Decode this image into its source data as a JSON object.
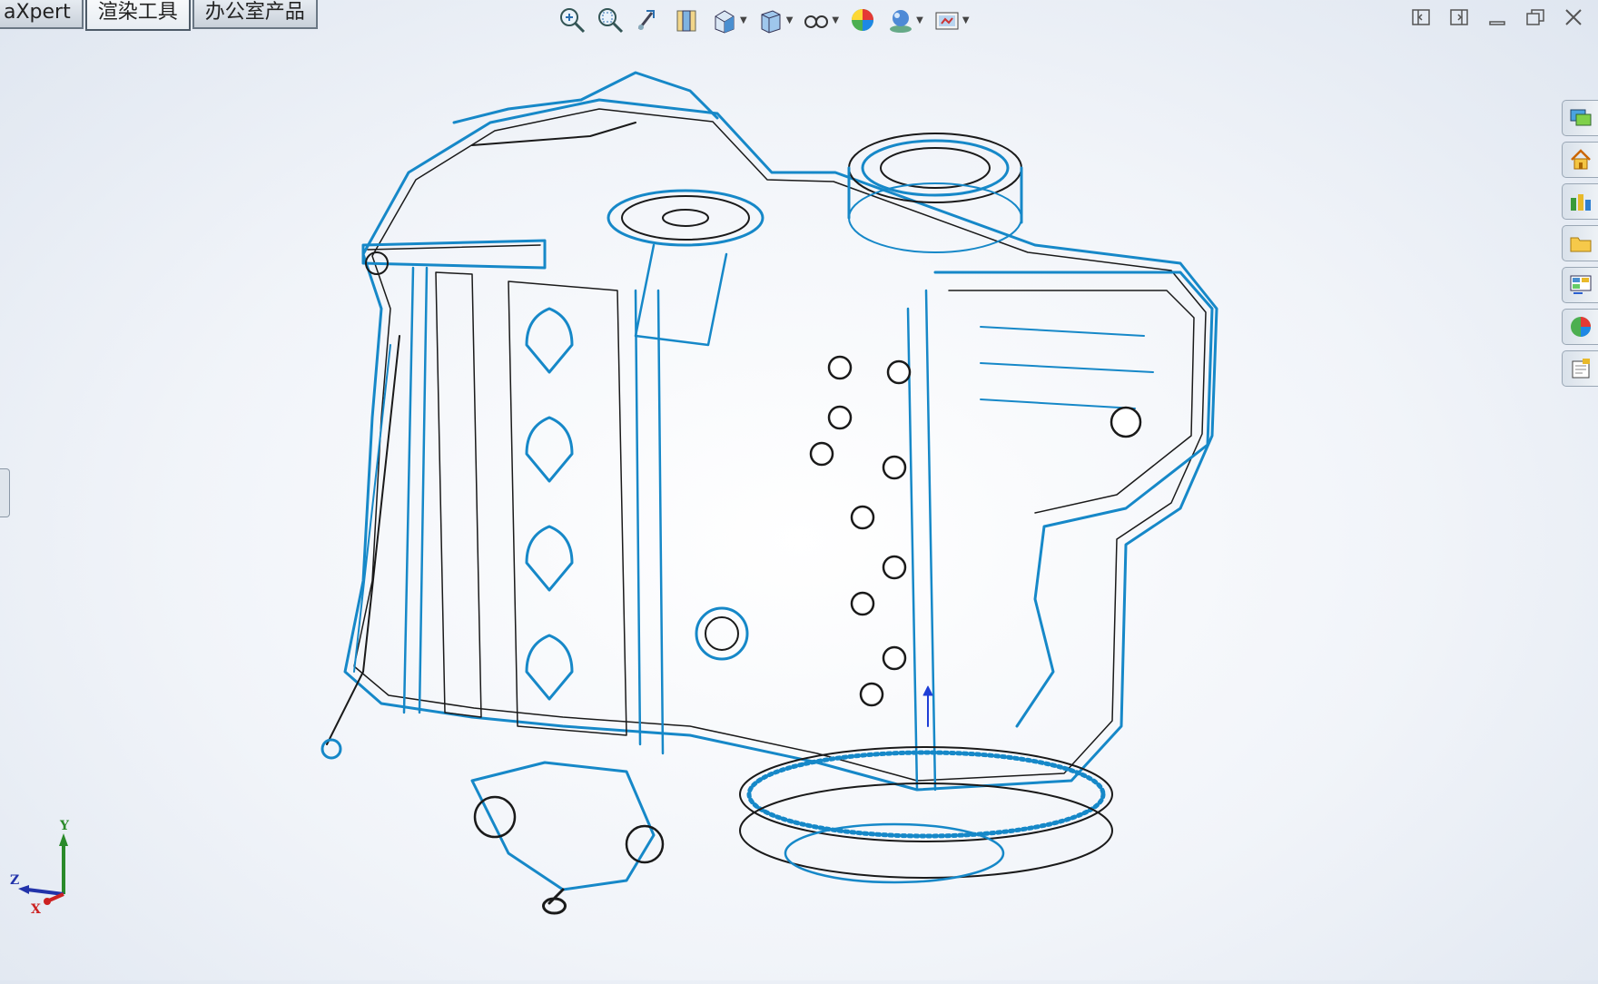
{
  "tabs": [
    {
      "label": "aXpert",
      "active": false
    },
    {
      "label": "渲染工具",
      "active": true
    },
    {
      "label": "办公室产品",
      "active": false
    }
  ],
  "heads_up_toolbar": [
    {
      "icon": "zoom-to-fit-icon"
    },
    {
      "icon": "zoom-to-area-icon"
    },
    {
      "icon": "previous-view-icon"
    },
    {
      "icon": "section-view-icon"
    },
    {
      "icon": "view-orientation-icon",
      "dropdown": true
    },
    {
      "icon": "display-style-icon",
      "dropdown": true
    },
    {
      "icon": "hide-show-items-icon",
      "dropdown": true
    },
    {
      "icon": "edit-appearance-icon"
    },
    {
      "icon": "apply-scene-icon",
      "dropdown": true
    },
    {
      "icon": "view-settings-icon",
      "dropdown": true
    }
  ],
  "window_controls": [
    "tile-left-icon",
    "tile-right-icon",
    "minimize-icon",
    "restore-icon",
    "close-icon"
  ],
  "task_pane": [
    "resources-icon",
    "home-icon",
    "design-library-icon",
    "file-explorer-icon",
    "view-palette-icon",
    "appearances-icon",
    "custom-properties-icon"
  ],
  "triad": {
    "x_label": "X",
    "y_label": "Y",
    "z_label": "Z"
  },
  "colors": {
    "edge_blue": "#1688c8",
    "edge_black": "#1a1a1a",
    "axis_x": "#cc2222",
    "axis_y": "#2a8a2a",
    "axis_z": "#2233aa"
  }
}
